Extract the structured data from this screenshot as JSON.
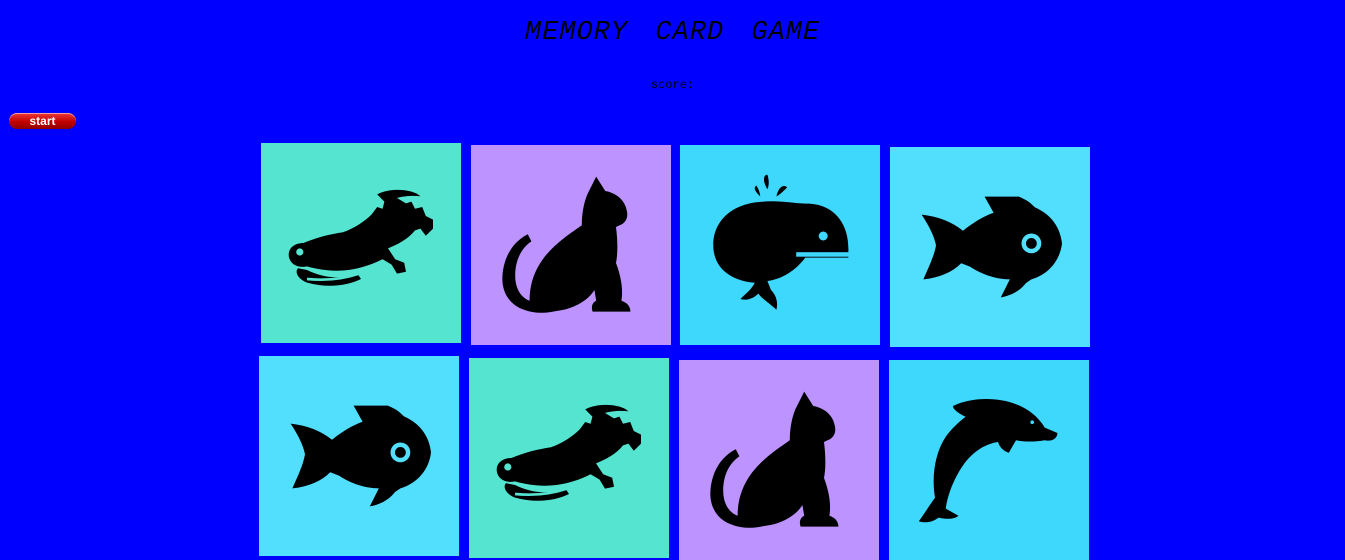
{
  "title": "MEMORY CARD GAME",
  "score_label": "score:",
  "start_label": "start",
  "colors": {
    "background": "#0000ff",
    "card_green": "#55e4d0",
    "card_purple": "#bd94ff",
    "card_cyan": "#3ed8fd",
    "card_light_cyan": "#52dffe",
    "eye": "#3ed8fd"
  },
  "cards": [
    {
      "animal": "crocodile-icon",
      "color": "#55e4d0"
    },
    {
      "animal": "cat-icon",
      "color": "#bd94ff"
    },
    {
      "animal": "whale-icon",
      "color": "#3ed8fd"
    },
    {
      "animal": "fish-icon",
      "color": "#52dffe"
    },
    {
      "animal": "fish-icon",
      "color": "#52dffe"
    },
    {
      "animal": "crocodile-icon",
      "color": "#55e4d0"
    },
    {
      "animal": "cat-icon",
      "color": "#bd94ff"
    },
    {
      "animal": "dolphin-icon",
      "color": "#3ed8fd"
    }
  ]
}
